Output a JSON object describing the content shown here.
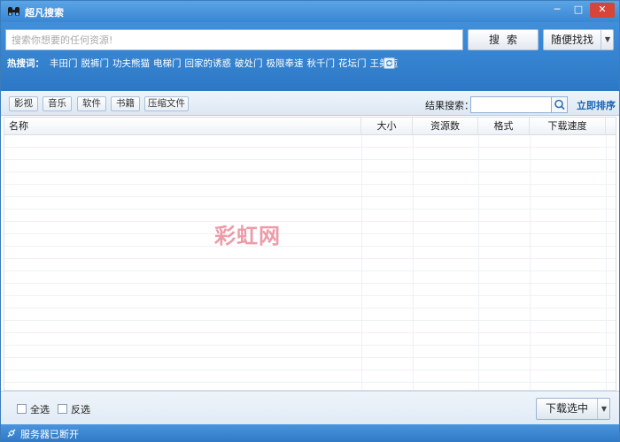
{
  "window": {
    "title": "超凡搜索",
    "controls": {
      "minimize": "─",
      "maximize": "□",
      "close": "✕"
    }
  },
  "search": {
    "placeholder": "搜索你想要的任何资源!",
    "value": "",
    "search_button": "搜索",
    "random_button": "随便找找",
    "random_arrow": "▼"
  },
  "hot": {
    "label": "热搜词：",
    "items": [
      "丰田门",
      "脱裤门",
      "功夫熊猫",
      "电梯门",
      "回家的诱惑",
      "破处门",
      "极限奉速",
      "秋千门",
      "花坛门",
      "王美莼"
    ]
  },
  "toolbar": {
    "categories": [
      "影视",
      "音乐",
      "软件",
      "书籍",
      "压缩文件"
    ],
    "result_search_label": "结果搜索：",
    "result_search_value": "",
    "sort_link": "立即排序"
  },
  "table": {
    "columns": {
      "name": "名称",
      "size": "大小",
      "count": "资源数",
      "format": "格式",
      "speed": "下载速度"
    },
    "rows": []
  },
  "watermark": "彩虹网",
  "footer": {
    "select_all": "全选",
    "invert_select": "反选",
    "download_button": "下载选中",
    "download_arrow": "▼"
  },
  "status": {
    "text": "服务器已断开"
  },
  "colors": {
    "title_bar": "#3b86d3",
    "header": "#2d78c6",
    "close_button": "#d7443a",
    "link": "#1a64b5",
    "watermark": "#e97a8c"
  }
}
